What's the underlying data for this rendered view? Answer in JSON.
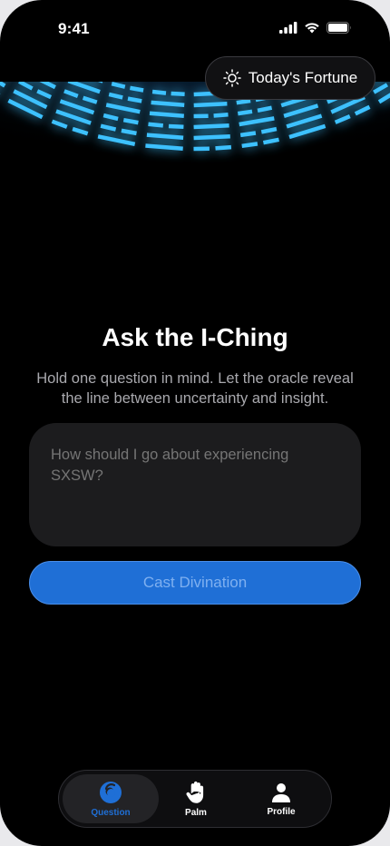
{
  "status_bar": {
    "time": "9:41",
    "icons": [
      "signal-icon",
      "wifi-icon",
      "battery-icon"
    ]
  },
  "fortune_button": {
    "label": "Today's Fortune",
    "icon": "sun-icon"
  },
  "main": {
    "title": "Ask the I-Ching",
    "subtitle": "Hold one question in mind. Let the oracle reveal the line between uncertainty and insight.",
    "question_placeholder": "How should I go about experiencing SXSW?",
    "cast_label": "Cast Divination"
  },
  "tab_bar": {
    "tabs": [
      {
        "label": "Question",
        "icon": "yin-yang-icon",
        "active": true
      },
      {
        "label": "Palm",
        "icon": "hand-icon",
        "active": false
      },
      {
        "label": "Profile",
        "icon": "person-icon",
        "active": false
      }
    ]
  },
  "colors": {
    "background": "#000000",
    "accent": "#1f6fd6",
    "glow": "#3ec1ff",
    "surface": "#1c1c1e"
  }
}
